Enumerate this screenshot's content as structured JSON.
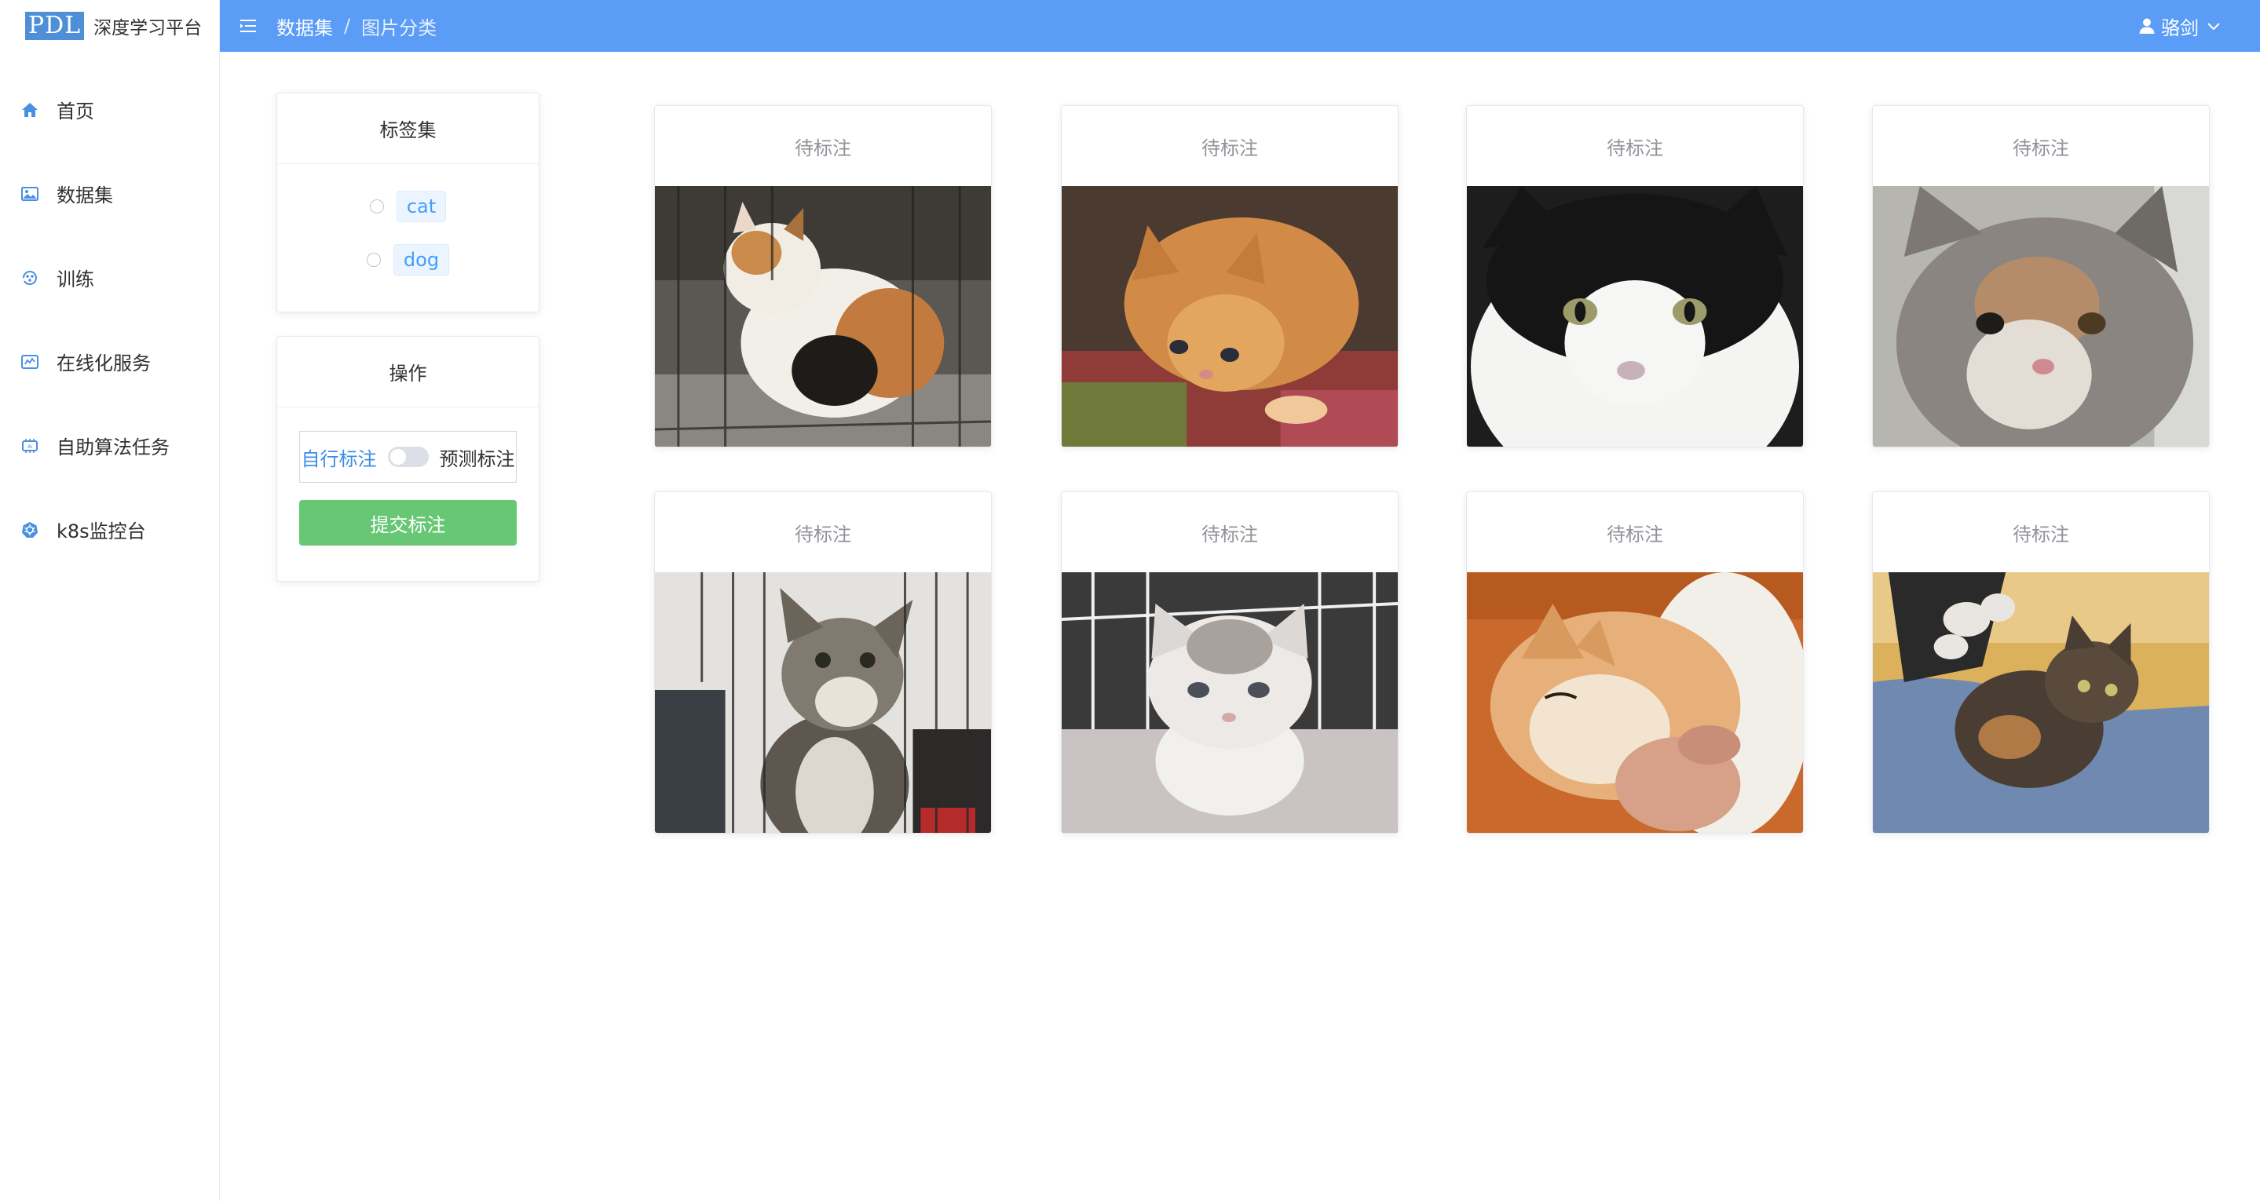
{
  "brand": {
    "logo_mark": "PDL",
    "name": "深度学习平台"
  },
  "sidebar": {
    "items": [
      {
        "label": "首页",
        "icon": "home-icon"
      },
      {
        "label": "数据集",
        "icon": "image-icon"
      },
      {
        "label": "训练",
        "icon": "training-icon"
      },
      {
        "label": "在线化服务",
        "icon": "service-icon"
      },
      {
        "label": "自助算法任务",
        "icon": "algorithm-icon"
      },
      {
        "label": "k8s监控台",
        "icon": "k8s-icon"
      }
    ]
  },
  "header": {
    "breadcrumb": [
      "数据集",
      "图片分类"
    ],
    "breadcrumb_separator": "/",
    "user_name": "骆剑"
  },
  "tags_panel": {
    "title": "标签集",
    "tags": [
      {
        "label": "cat"
      },
      {
        "label": "dog"
      }
    ]
  },
  "ops_panel": {
    "title": "操作",
    "mode_left": "自行标注",
    "mode_right": "预测标注",
    "switch_on": false,
    "submit_label": "提交标注"
  },
  "images": [
    {
      "status": "待标注",
      "subject": "calico cat in cage"
    },
    {
      "status": "待标注",
      "subject": "orange kitten on colorful blanket"
    },
    {
      "status": "待标注",
      "subject": "black and white cat close-up"
    },
    {
      "status": "待标注",
      "subject": "gray calico kitten face"
    },
    {
      "status": "待标注",
      "subject": "tabby kitten looking up in cage"
    },
    {
      "status": "待标注",
      "subject": "white fluffy kitten on towel"
    },
    {
      "status": "待标注",
      "subject": "orange cat held in hands"
    },
    {
      "status": "待标注",
      "subject": "tortoiseshell kitten on lap"
    }
  ],
  "colors": {
    "header_bg": "#5a9cf6",
    "accent": "#409eff",
    "submit_bg": "#67c774",
    "tag_bg": "#ecf5ff"
  }
}
